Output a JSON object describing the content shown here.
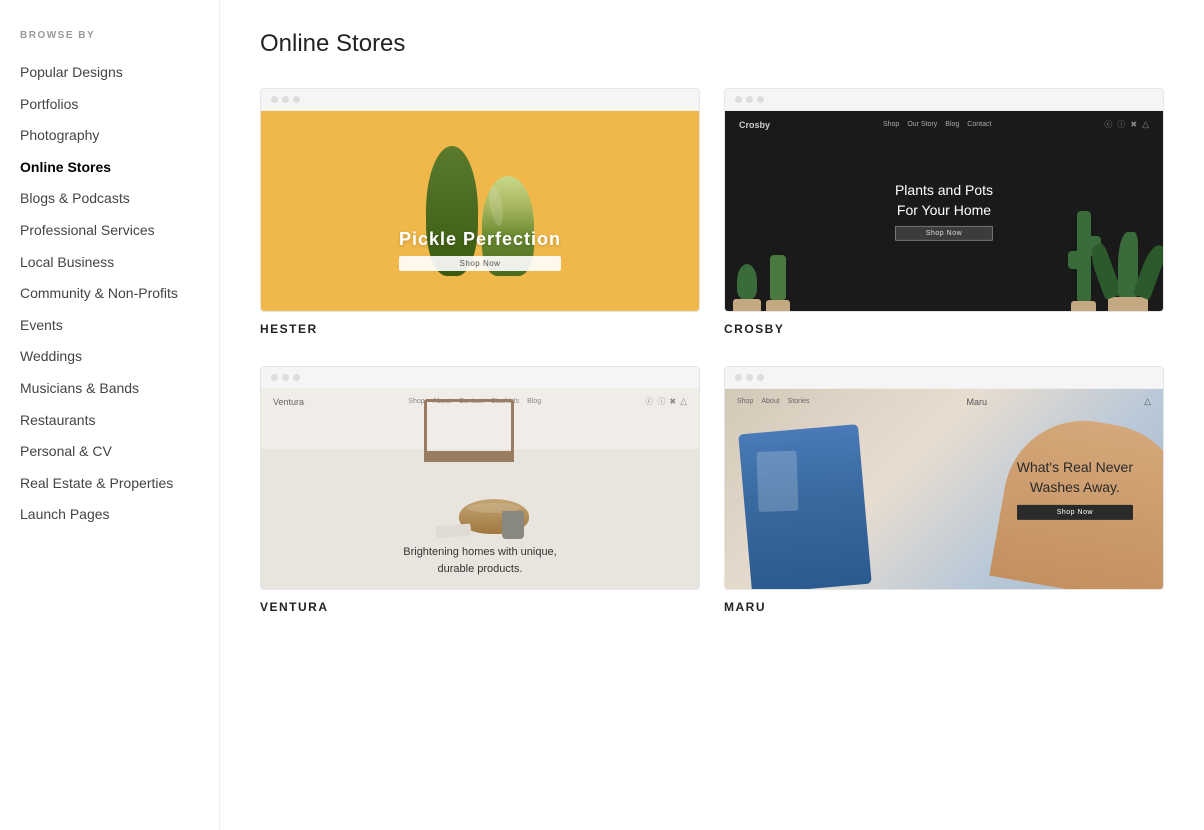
{
  "sidebar": {
    "browse_label": "BROWSE BY",
    "items": [
      {
        "id": "popular-designs",
        "label": "Popular Designs",
        "active": false
      },
      {
        "id": "portfolios",
        "label": "Portfolios",
        "active": false
      },
      {
        "id": "photography",
        "label": "Photography",
        "active": false
      },
      {
        "id": "online-stores",
        "label": "Online Stores",
        "active": true
      },
      {
        "id": "blogs-podcasts",
        "label": "Blogs & Podcasts",
        "active": false
      },
      {
        "id": "professional-services",
        "label": "Professional Services",
        "active": false
      },
      {
        "id": "local-business",
        "label": "Local Business",
        "active": false
      },
      {
        "id": "community-non-profits",
        "label": "Community & Non-Profits",
        "active": false
      },
      {
        "id": "events",
        "label": "Events",
        "active": false
      },
      {
        "id": "weddings",
        "label": "Weddings",
        "active": false
      },
      {
        "id": "musicians-bands",
        "label": "Musicians & Bands",
        "active": false
      },
      {
        "id": "restaurants",
        "label": "Restaurants",
        "active": false
      },
      {
        "id": "personal-cv",
        "label": "Personal & CV",
        "active": false
      },
      {
        "id": "real-estate",
        "label": "Real Estate & Properties",
        "active": false
      },
      {
        "id": "launch-pages",
        "label": "Launch Pages",
        "active": false
      }
    ]
  },
  "main": {
    "title": "Online Stores",
    "templates": [
      {
        "id": "hester",
        "name": "HESTER",
        "theme": "hester",
        "headline": "Pickle Perfection",
        "cta": "Shop Now"
      },
      {
        "id": "crosby",
        "name": "CROSBY",
        "theme": "crosby",
        "headline": "Plants and Pots\nFor Your Home",
        "cta": "Shop Now",
        "nav_logo": "Crosby",
        "nav_links": [
          "Shop",
          "Our Story",
          "Blog",
          "Contact"
        ]
      },
      {
        "id": "ventura",
        "name": "VENTURA",
        "theme": "ventura",
        "headline": "Brightening homes with unique,\ndurable products.",
        "nav_logo": "Ventura",
        "nav_links": [
          "Shop",
          "About",
          "Contact",
          "Stockists",
          "Blog"
        ]
      },
      {
        "id": "maru",
        "name": "MARU",
        "theme": "maru",
        "headline": "What's Real Never\nWashes Away.",
        "cta": "Shop Now",
        "nav_logo": "Maru",
        "nav_links": [
          "Shop",
          "About",
          "Stories"
        ]
      }
    ]
  }
}
